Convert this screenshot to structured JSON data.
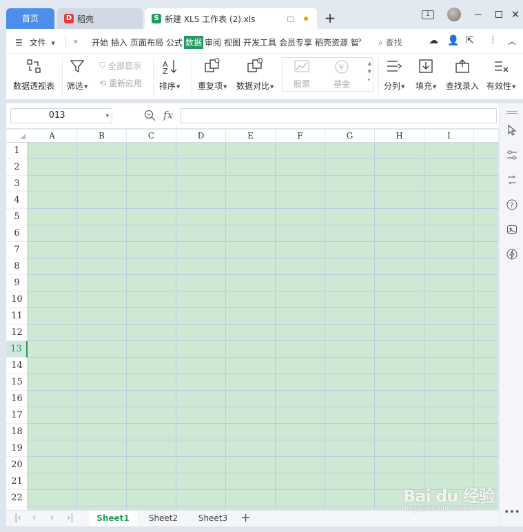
{
  "titlebar": {
    "home_tab": "首页",
    "tabs": [
      {
        "label": "稻壳",
        "icon": "daoke-logo-icon"
      },
      {
        "label": "新建 XLS 工作表 (2).xls",
        "icon": "sheet-s-icon"
      }
    ],
    "window_badge": "1"
  },
  "menubar": {
    "file_label": "文件",
    "items": [
      "开始",
      "插入",
      "页面布局",
      "公式",
      "数据",
      "审阅",
      "视图",
      "开发工具",
      "会员专享",
      "稻壳资源",
      "智"
    ],
    "active_item": "数据",
    "search_label": "查找"
  },
  "ribbon": {
    "pivot": "数据透视表",
    "filter": "筛选",
    "show_all": "全部显示",
    "reapply": "重新应用",
    "sort": "排序",
    "duplicates": "重复项",
    "compare": "数据对比",
    "stocks": "股票",
    "funds": "基金",
    "split": "分列",
    "fill": "填充",
    "lookup": "查找录入",
    "validity": "有效性"
  },
  "formulabar": {
    "namebox_value": "O13",
    "fx_label": "fx",
    "formula_value": ""
  },
  "grid": {
    "columns": [
      "A",
      "B",
      "C",
      "D",
      "E",
      "F",
      "G",
      "H",
      "I"
    ],
    "rows": [
      "1",
      "2",
      "3",
      "4",
      "5",
      "6",
      "7",
      "8",
      "9",
      "10",
      "11",
      "12",
      "13",
      "14",
      "15",
      "16",
      "17",
      "18",
      "19",
      "20",
      "21",
      "22"
    ],
    "selected_row": "13",
    "cell_fill": "#cfe8d3",
    "accent": "#1e9d5f"
  },
  "sheets": {
    "tabs": [
      "Sheet1",
      "Sheet2",
      "Sheet3"
    ],
    "active": "Sheet1"
  },
  "watermark": {
    "brand": "Bai du 经验",
    "url": "jingyan.baidu.com"
  }
}
